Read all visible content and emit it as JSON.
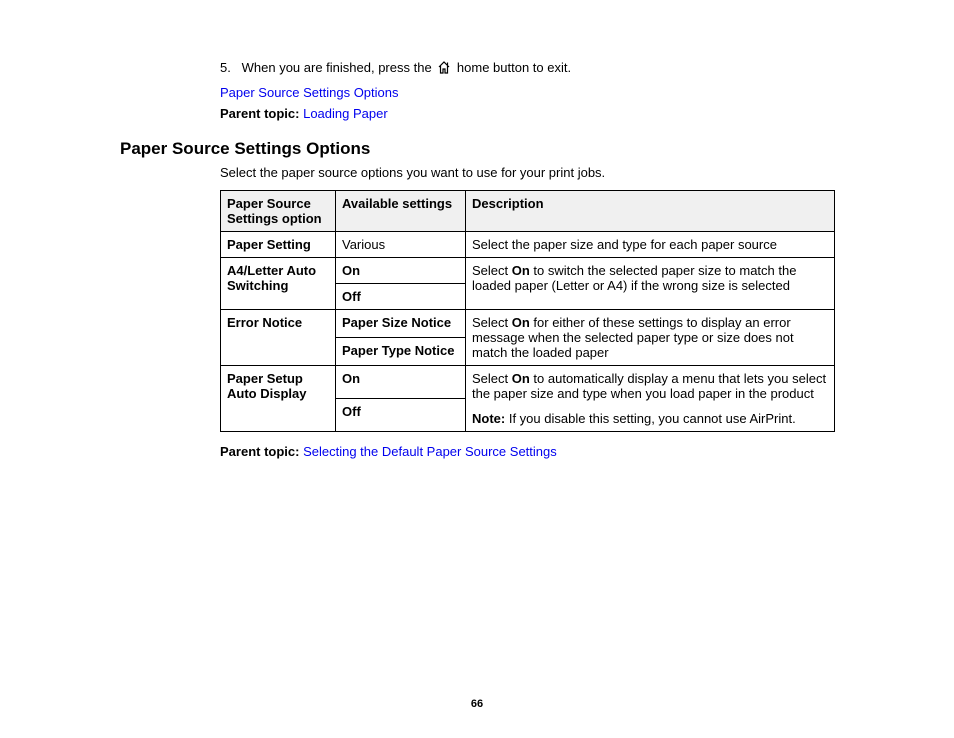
{
  "step": {
    "number": "5.",
    "before": "When you are finished, press the ",
    "after": " home button to exit."
  },
  "relatedLink": "Paper Source Settings Options",
  "parentTopic1": {
    "label": "Parent topic:",
    "link": "Loading Paper"
  },
  "heading": "Paper Source Settings Options",
  "intro": "Select the paper source options you want to use for your print jobs.",
  "table": {
    "head": {
      "c1": "Paper Source Settings option",
      "c2": "Available settings",
      "c3": "Description"
    },
    "r1": {
      "c1": "Paper Setting",
      "c2": "Various",
      "c3": "Select the paper size and type for each paper source"
    },
    "r2": {
      "c1": "A4/Letter Auto Switching",
      "c2a": "On",
      "c2b": "Off",
      "c3_pre": "Select ",
      "c3_bold": "On",
      "c3_post": " to switch the selected paper size to match the loaded paper (Letter or A4) if the wrong size is selected"
    },
    "r3": {
      "c1": "Error Notice",
      "c2a": "Paper Size Notice",
      "c2b": "Paper Type Notice",
      "c3_pre": "Select ",
      "c3_bold": "On",
      "c3_post": " for either of these settings to display an error message when the selected paper type or size does not match the loaded paper"
    },
    "r4": {
      "c1": "Paper Setup Auto Display",
      "c2a": "On",
      "c2b": "Off",
      "c3_pre": "Select ",
      "c3_bold": "On",
      "c3_post": " to automatically display a menu that lets you select the paper size and type when you load paper in the product",
      "note_label": "Note:",
      "note_text": " If you disable this setting, you cannot use AirPrint."
    }
  },
  "parentTopic2": {
    "label": "Parent topic:",
    "link": "Selecting the Default Paper Source Settings"
  },
  "pageNumber": "66"
}
